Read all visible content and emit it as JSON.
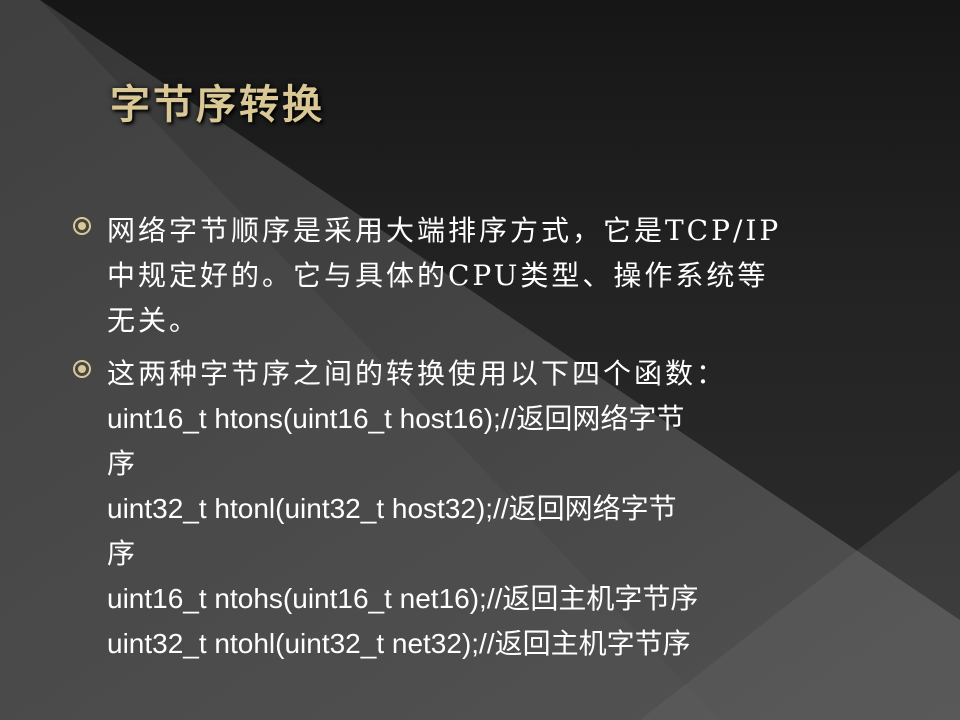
{
  "slide": {
    "title": "字节序转换",
    "accent_color": "#d9c796",
    "bullet_icon": "circle-bullet-icon",
    "bullets": [
      {
        "lines": [
          "网络字节顺序是采用大端排序方式，它是TCP/IP",
          "中规定好的。它与具体的CPU类型、操作系统等",
          "无关。"
        ]
      },
      {
        "intro": "这两种字节序之间的转换使用以下四个函数：",
        "lines": [
          "uint16_t htons(uint16_t host16);//返回网络字节",
          "序",
          "uint32_t htonl(uint32_t host32);//返回网络字节",
          "序",
          "uint16_t ntohs(uint16_t net16);//返回主机字节序",
          "uint32_t ntohl(uint32_t net32);//返回主机字节序"
        ]
      }
    ]
  }
}
